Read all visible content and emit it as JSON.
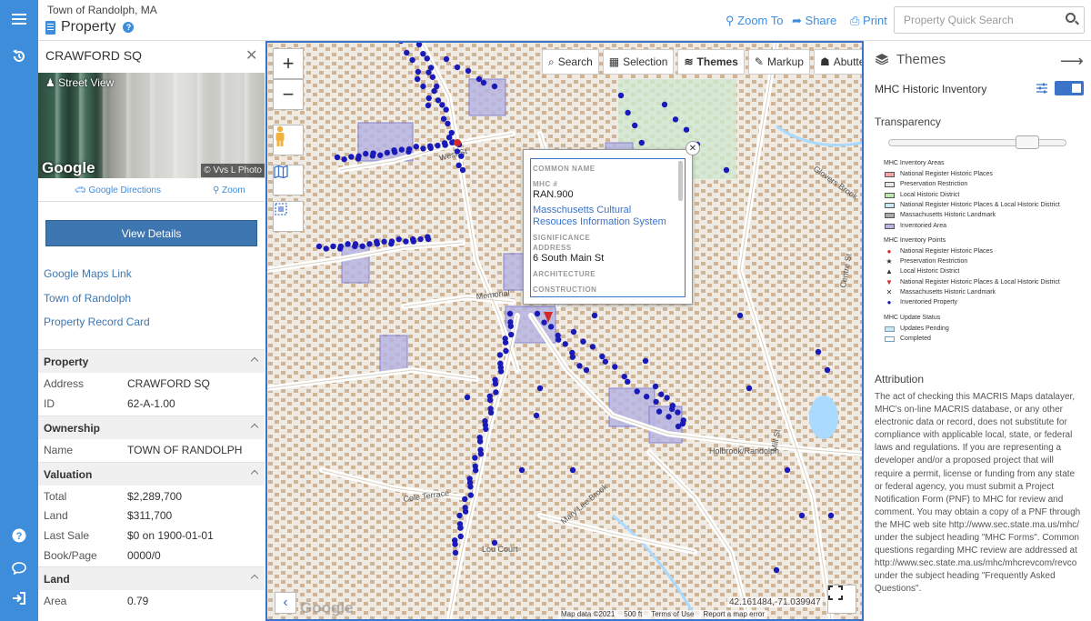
{
  "header": {
    "town": "Town of Randolph, MA",
    "module": "Property",
    "links": [
      "Zoom To",
      "Share",
      "Print"
    ],
    "search_placeholder": "Property Quick Search"
  },
  "rail": {
    "icons": [
      "menu-icon",
      "history-icon",
      "help-icon",
      "chat-icon",
      "sign-in-icon"
    ]
  },
  "property": {
    "address_title": "CRAWFORD SQ",
    "street_view_label": "Street View",
    "photo_brand": "Google",
    "photo_credit": "© Vvs L Photo",
    "directions_label": "Google Directions",
    "zoom_label": "Zoom",
    "view_details_label": "View Details",
    "links": [
      "Google Maps Link",
      "Town of Randolph",
      "Property Record Card"
    ]
  },
  "sections": {
    "property": {
      "title": "Property",
      "rows": [
        {
          "k": "Address",
          "v": "CRAWFORD SQ"
        },
        {
          "k": "ID",
          "v": "62-A-1.00"
        }
      ]
    },
    "ownership": {
      "title": "Ownership",
      "rows": [
        {
          "k": "Name",
          "v": "TOWN OF RANDOLPH"
        }
      ]
    },
    "valuation": {
      "title": "Valuation",
      "rows": [
        {
          "k": "Total",
          "v": "$2,289,700"
        },
        {
          "k": "Land",
          "v": "$311,700"
        },
        {
          "k": "Last Sale",
          "v": "$0 on 1900-01-01"
        },
        {
          "k": "Book/Page",
          "v": "0000/0"
        }
      ]
    },
    "land": {
      "title": "Land",
      "rows": [
        {
          "k": "Area",
          "v": "0.79"
        }
      ]
    }
  },
  "map": {
    "toolbar": [
      "Search",
      "Selection",
      "Themes",
      "Markup",
      "Abutters"
    ],
    "popup": {
      "labels": [
        "COMMON NAME",
        "MHC #",
        "SIGNIFICANCE",
        "ADDRESS",
        "ARCHITECTURE",
        "CONSTRUCTION"
      ],
      "mhc_number": "RAN.900",
      "link": "Masschusetts Cultural Resouces Information System",
      "address": "6 South Main St"
    },
    "coords": "42.161484,-71.039947",
    "footer": [
      "Map data ©2021",
      "500 ft",
      "Terms of Use",
      "Report a map error"
    ],
    "logo": "Google",
    "street_labels": [
      "West St",
      "Memorial",
      "Cole Terrace",
      "Lou Court",
      "Mary Lee Brook",
      "Glovers Brook",
      "Holbrook/Randolph",
      "Centre St",
      "Mill St"
    ],
    "colors": {
      "point": "#1a1ab8",
      "area": "#b8b5e3",
      "building": "#b5875a",
      "road": "#ffffff",
      "water": "#aadaff",
      "park": "#cfe8cf"
    }
  },
  "themes": {
    "title": "Themes",
    "layer_name": "MHC Historic Inventory",
    "transparency_label": "Transparency",
    "transparency_value": 0.78,
    "legend": {
      "areas_title": "MHC Inventory Areas",
      "areas": [
        {
          "label": "National Register Historic Places",
          "color": "#f4a6a6"
        },
        {
          "label": "Preservation Restriction",
          "color": "#e6e6e6"
        },
        {
          "label": "Local Historic District",
          "color": "#bfe6b0"
        },
        {
          "label": "National Register Historic Places & Local Historic District",
          "color": "#c9e8f3"
        },
        {
          "label": "Massachusetts Historic Landmark",
          "color": "#aaaaaa"
        },
        {
          "label": "Inventoried Area",
          "color": "#b8b5e3"
        }
      ],
      "points_title": "MHC Inventory Points",
      "points": [
        {
          "label": "National Register Historic Places",
          "color": "#d12a2a",
          "glyph": "●"
        },
        {
          "label": "Preservation Restriction",
          "color": "#333333",
          "glyph": "★"
        },
        {
          "label": "Local Historic District",
          "color": "#333333",
          "glyph": "▲"
        },
        {
          "label": "National Register Historic Places & Local Historic District",
          "color": "#d12a2a",
          "glyph": "▼"
        },
        {
          "label": "Massachusetts Historic Landmark",
          "color": "#333333",
          "glyph": "✕"
        },
        {
          "label": "Inventoried Property",
          "color": "#1a1ab8",
          "glyph": "●"
        }
      ],
      "update_title": "MHC Update Status",
      "update": [
        {
          "label": "Updates Pending",
          "color": "#c9e8f3"
        },
        {
          "label": "Completed",
          "color": "#ffffff"
        }
      ]
    },
    "attribution_title": "Attribution",
    "attribution": "The act of checking this MACRIS Maps datalayer, MHC's on-line MACRIS database, or any other electronic data or record, does not substitute for compliance with applicable local, state, or federal laws and regulations. If you are representing a developer and/or a proposed project that will require a permit, license or funding from any state or federal agency, you must submit a Project Notification Form (PNF) to MHC for review and comment. You may obtain a copy of a PNF through the MHC web site http://www.sec.state.ma.us/mhc/ under the subject heading \"MHC Forms\". Common questions regarding MHC review are addressed at http://www.sec.state.ma.us/mhc/mhcrevcom/revco under the subject heading \"Frequently Asked Questions\"."
  }
}
